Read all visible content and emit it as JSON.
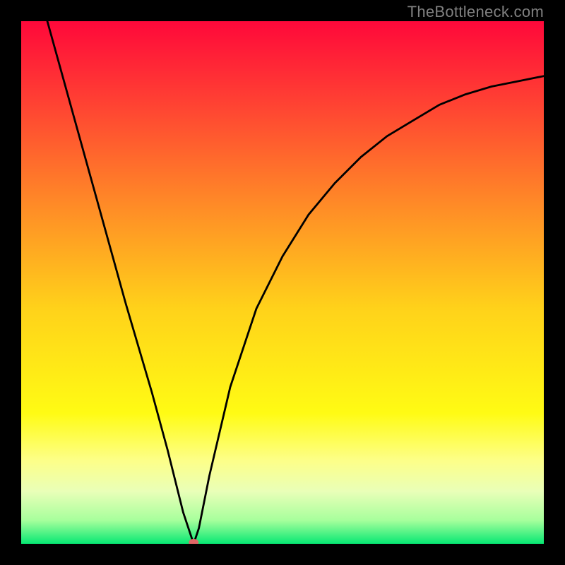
{
  "source_label": "TheBottleneck.com",
  "chart_data": {
    "type": "line",
    "title": "",
    "xlabel": "",
    "ylabel": "",
    "xlim": [
      0,
      100
    ],
    "ylim": [
      0,
      100
    ],
    "x_optimum": 33,
    "series": [
      {
        "name": "bottleneck-curve",
        "x": [
          5,
          10,
          15,
          20,
          25,
          28,
          30,
          31,
          32,
          33,
          34,
          36,
          40,
          45,
          50,
          55,
          60,
          65,
          70,
          75,
          80,
          85,
          90,
          95,
          100
        ],
        "values": [
          100,
          82,
          64,
          46,
          29,
          18,
          10,
          6,
          3,
          0,
          3,
          13,
          30,
          45,
          55,
          63,
          69,
          74,
          78,
          81,
          84,
          86,
          87.5,
          88.5,
          89.5
        ]
      }
    ],
    "marker": {
      "x": 33,
      "y": 0,
      "color": "#e06666"
    },
    "gradient_stops": [
      {
        "offset": 0.0,
        "color": "#ff083a"
      },
      {
        "offset": 0.15,
        "color": "#ff3f33"
      },
      {
        "offset": 0.35,
        "color": "#ff8a27"
      },
      {
        "offset": 0.55,
        "color": "#ffd21a"
      },
      {
        "offset": 0.75,
        "color": "#fffb14"
      },
      {
        "offset": 0.84,
        "color": "#fdff88"
      },
      {
        "offset": 0.9,
        "color": "#e9ffb8"
      },
      {
        "offset": 0.955,
        "color": "#a7ff9c"
      },
      {
        "offset": 1.0,
        "color": "#07e873"
      }
    ]
  }
}
